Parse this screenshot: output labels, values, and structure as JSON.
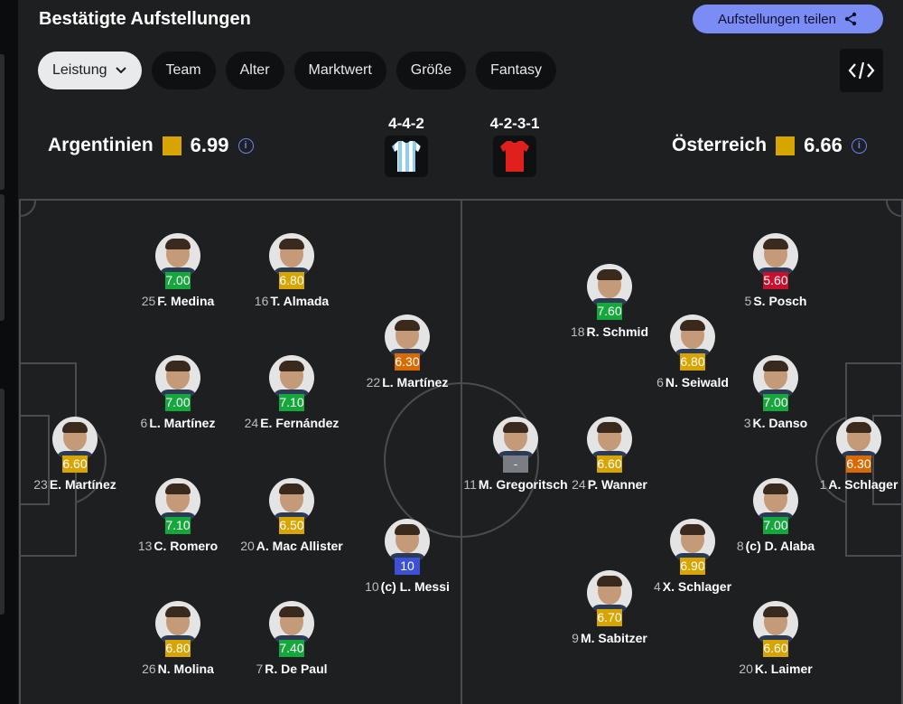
{
  "header": {
    "title": "Bestätigte Aufstellungen",
    "share_label": "Aufstellungen teilen"
  },
  "tabs": [
    {
      "label": "Leistung",
      "active": true
    },
    {
      "label": "Team"
    },
    {
      "label": "Alter"
    },
    {
      "label": "Marktwert"
    },
    {
      "label": "Größe"
    },
    {
      "label": "Fantasy"
    }
  ],
  "icons": {
    "share": "share-icon",
    "embed": "code-embed-icon",
    "info": "info-icon",
    "chevron": "chevron-down-icon"
  },
  "colors": {
    "high": "#14a83c",
    "mid": "#d7a400",
    "low": "#d86a00",
    "bad": "#c8102e",
    "top": "#3c51d6",
    "none": "#7a7d83",
    "accent": "#7c8cf5"
  },
  "home": {
    "name": "Argentinien",
    "rating": "6.99",
    "formation": "4-4-2"
  },
  "away": {
    "name": "Österreich",
    "rating": "6.66",
    "formation": "4-2-3-1"
  },
  "players": [
    {
      "num": "25",
      "name": "F. Medina",
      "rating": "7.00",
      "color": "high"
    },
    {
      "num": "16",
      "name": "T. Almada",
      "rating": "6.80",
      "color": "mid"
    },
    {
      "num": "22",
      "name": "L. Martínez",
      "rating": "6.30",
      "color": "low"
    },
    {
      "num": "6",
      "name": "L. Martínez",
      "rating": "7.00",
      "color": "high"
    },
    {
      "num": "24",
      "name": "E. Fernández",
      "rating": "7.10",
      "color": "high"
    },
    {
      "num": "23",
      "name": "E. Martínez",
      "rating": "6.60",
      "color": "mid"
    },
    {
      "num": "13",
      "name": "C. Romero",
      "rating": "7.10",
      "color": "high"
    },
    {
      "num": "20",
      "name": "A. Mac Allister",
      "rating": "6.50",
      "color": "mid"
    },
    {
      "num": "10",
      "name": "(c) L. Messi",
      "rating": "10",
      "color": "top"
    },
    {
      "num": "26",
      "name": "N. Molina",
      "rating": "6.80",
      "color": "mid"
    },
    {
      "num": "7",
      "name": "R. De Paul",
      "rating": "7.40",
      "color": "high"
    },
    {
      "num": "11",
      "name": "M. Gregoritsch",
      "rating": "-",
      "color": "none"
    },
    {
      "num": "18",
      "name": "R. Schmid",
      "rating": "7.60",
      "color": "high"
    },
    {
      "num": "6",
      "name": "N. Seiwald",
      "rating": "6.80",
      "color": "mid"
    },
    {
      "num": "24",
      "name": "P. Wanner",
      "rating": "6.60",
      "color": "mid"
    },
    {
      "num": "4",
      "name": "X. Schlager",
      "rating": "6.90",
      "color": "mid"
    },
    {
      "num": "9",
      "name": "M. Sabitzer",
      "rating": "6.70",
      "color": "mid"
    },
    {
      "num": "5",
      "name": "S. Posch",
      "rating": "5.60",
      "color": "bad"
    },
    {
      "num": "3",
      "name": "K. Danso",
      "rating": "7.00",
      "color": "high"
    },
    {
      "num": "8",
      "name": "(c) D. Alaba",
      "rating": "7.00",
      "color": "high"
    },
    {
      "num": "20",
      "name": "K. Laimer",
      "rating": "6.60",
      "color": "mid"
    },
    {
      "num": "1",
      "name": "A. Schlager",
      "rating": "6.30",
      "color": "low"
    }
  ]
}
